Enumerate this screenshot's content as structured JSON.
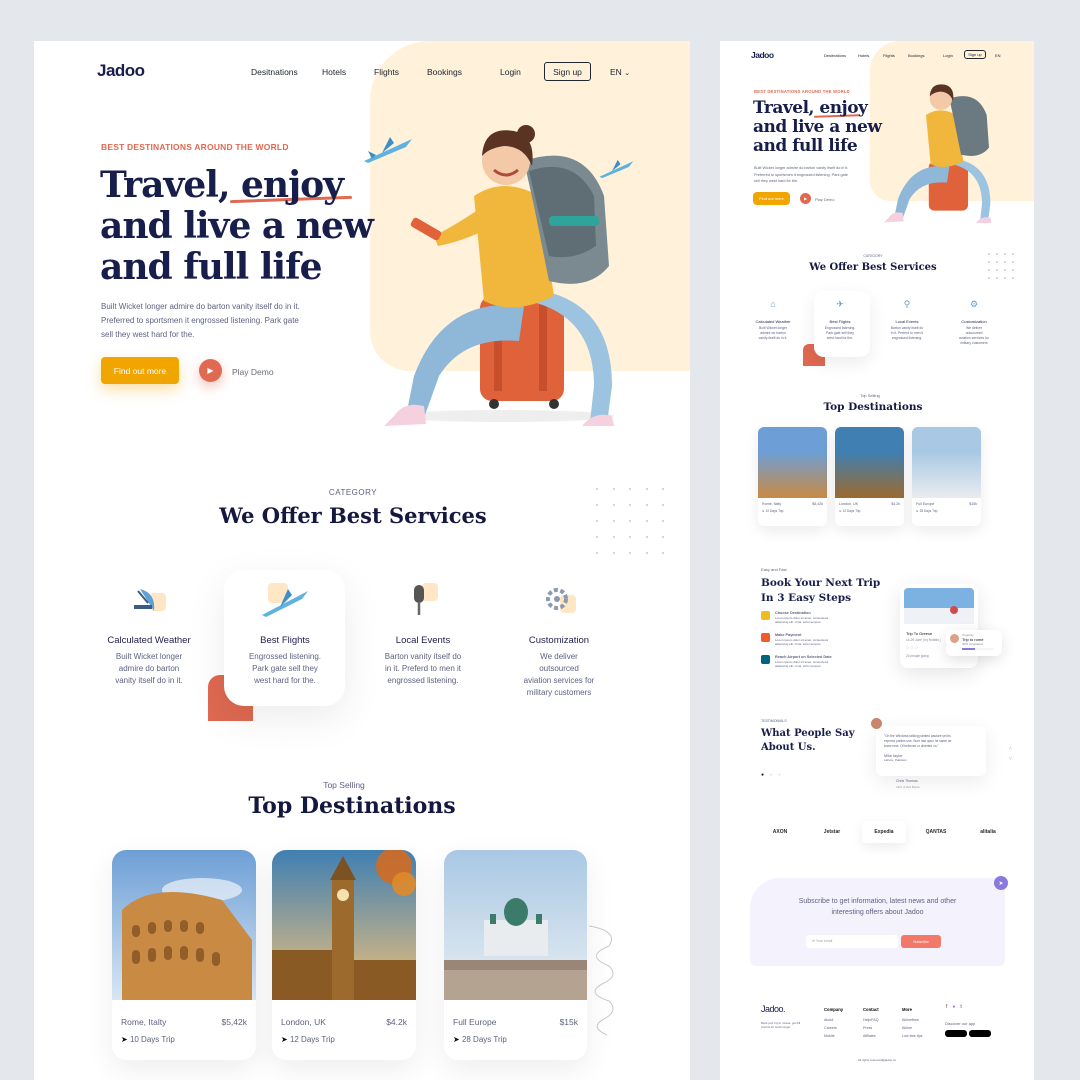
{
  "left": {
    "logo": "Jadoo",
    "nav": [
      "Desitnations",
      "Hotels",
      "Flights",
      "Bookings"
    ],
    "login": "Login",
    "signup": "Sign up",
    "lang": "EN",
    "eyebrow": "BEST DESTINATIONS AROUND THE WORLD",
    "hero_lines": [
      "Travel, enjoy",
      "and live a new",
      "and full life"
    ],
    "hero_para": [
      "Built Wicket longer admire do barton vanity itself do in it.",
      "Preferred to sportsmen it engrossed listening. Park gate",
      "sell they west hard for the."
    ],
    "cta": "Find out more",
    "play_demo": "Play Demo",
    "services_eyebrow": "CATEGORY",
    "services_title": "We Offer Best Services",
    "services": [
      {
        "title": "Calculated Weather",
        "desc": [
          "Built Wicket longer",
          "admire do barton",
          "vanity itself do in it."
        ]
      },
      {
        "title": "Best Flights",
        "desc": [
          "Engrossed listening.",
          "Park gate sell they",
          "west hard for the."
        ]
      },
      {
        "title": "Local Events",
        "desc": [
          "Barton vanity itself do",
          "in it. Preferd to men it",
          "engrossed listening."
        ]
      },
      {
        "title": "Customization",
        "desc": [
          "We deliver",
          "outsourced",
          "aviation services for",
          "military customers"
        ]
      }
    ],
    "dest_eyebrow": "Top Selling",
    "dest_title": "Top Destinations",
    "destinations": [
      {
        "place": "Rome, Italty",
        "price": "$5,42k",
        "trip": "10 Days Trip"
      },
      {
        "place": "London, UK",
        "price": "$4.2k",
        "trip": "12 Days Trip"
      },
      {
        "place": "Full Europe",
        "price": "$15k",
        "trip": "28 Days Trip"
      }
    ]
  },
  "right": {
    "logo": "Jadoo",
    "nav": [
      "Desitnations",
      "Hotels",
      "Flights",
      "Bookings"
    ],
    "login": "Login",
    "signup": "Sign up",
    "lang": "EN",
    "eyebrow": "BEST DESTINATIONS AROUND THE WORLD",
    "hero_lines": [
      "Travel, enjoy",
      "and live a new",
      "and full life"
    ],
    "hero_para": [
      "Built Wicket longer admire do barton vanity itself do in it.",
      "Preferred to sportsmen it engrossed listening. Park gate",
      "sell they west hard for the."
    ],
    "cta": "Find out more",
    "play_demo": "Play Demo",
    "services_eyebrow": "CATEGORY",
    "services_title": "We Offer Best Services",
    "services": [
      {
        "title": "Calculated Weather",
        "desc": [
          "Built Wicket longer",
          "admire do barton",
          "vanity itself do in it."
        ]
      },
      {
        "title": "Best Flights",
        "desc": [
          "Engrossed listening.",
          "Park gate sell they",
          "west hard for the."
        ]
      },
      {
        "title": "Local Events",
        "desc": [
          "Barton vanity itself do",
          "in it. Preferd to men it",
          "engrossed listening."
        ]
      },
      {
        "title": "Customization",
        "desc": [
          "We deliver",
          "outsourced",
          "aviation services for",
          "military customers"
        ]
      }
    ],
    "dest_eyebrow": "Top Selling",
    "dest_title": "Top Destinations",
    "destinations": [
      {
        "place": "Rome, Italty",
        "price": "$5,42k",
        "trip": "10 Days Trip"
      },
      {
        "place": "London, UK",
        "price": "$4.2k",
        "trip": "12 Days Trip"
      },
      {
        "place": "Full Europe",
        "price": "$15k",
        "trip": "28 Days Trip"
      }
    ],
    "steps_eyebrow": "Easy and Fast",
    "steps_title": [
      "Book Your Next Trip",
      "In 3 Easy Steps"
    ],
    "steps": [
      {
        "title": "Choose Destination",
        "desc": [
          "Lorem ipsum dolor sit amet, consectetur",
          "adipiscing elit. Urna, tortor tempus."
        ],
        "color": "#f0bb1f"
      },
      {
        "title": "Make Payment",
        "desc": [
          "Lorem ipsum dolor sit amet, consectetur",
          "adipiscing elit. Urna, tortor tempus."
        ],
        "color": "#f15a2b"
      },
      {
        "title": "Reach Airport on Selected Date",
        "desc": [
          "Lorem ipsum dolor sit amet, consectetur",
          "adipiscing elit. Urna, tortor tempus."
        ],
        "color": "#006380"
      }
    ],
    "trip_card": {
      "title": "Trip To Greece",
      "meta": "14-29 June  |  by Robbin j",
      "people": "24 people going"
    },
    "ongoing": {
      "label": "Ongoing",
      "title": "Trip to rome",
      "progress": "40% completed",
      "progress_pct": 40
    },
    "testimonials_eyebrow": "TESTIMONIALS",
    "testimonials_title": [
      "What People Say",
      "About Us."
    ],
    "quote": [
      "\"On the Windows talking painted pasture yet its",
      "express parties use. Sure last upon he same as",
      "knew next. Of believed or diverted no.\""
    ],
    "reviewer": {
      "name": "Mike taylor",
      "place": "Lahore, Pakistan"
    },
    "reviewer2": {
      "name": "Chris Thomas",
      "place": "CEO of Red Button"
    },
    "partners": [
      "AXON",
      "Jetstar",
      "Expedia",
      "QANTAS",
      "alitalia"
    ],
    "subscribe": [
      "Subscribe to get information, latest news and other",
      "interesting offers about Jadoo"
    ],
    "email_placeholder": "Your email",
    "subscribe_btn": "Subscribe",
    "footer_logo": "Jadoo.",
    "footer_tagline": [
      "Book your trip in minute, get full",
      "Control for much longer."
    ],
    "footer_cols": [
      {
        "title": "Company",
        "items": [
          "About",
          "Careers",
          "Mobile"
        ]
      },
      {
        "title": "Contact",
        "items": [
          "Help/FAQ",
          "Press",
          "Affilates"
        ]
      },
      {
        "title": "More",
        "items": [
          "Airlinefees",
          "Airline",
          "Low fare tips"
        ]
      }
    ],
    "discover_app": "Discover our app",
    "copyright": "All rights reserved@jadoo.co"
  },
  "colors": {
    "accent": "#df6951",
    "yellow": "#f1a501",
    "navy": "#181e4b",
    "cream": "#fff1da"
  }
}
